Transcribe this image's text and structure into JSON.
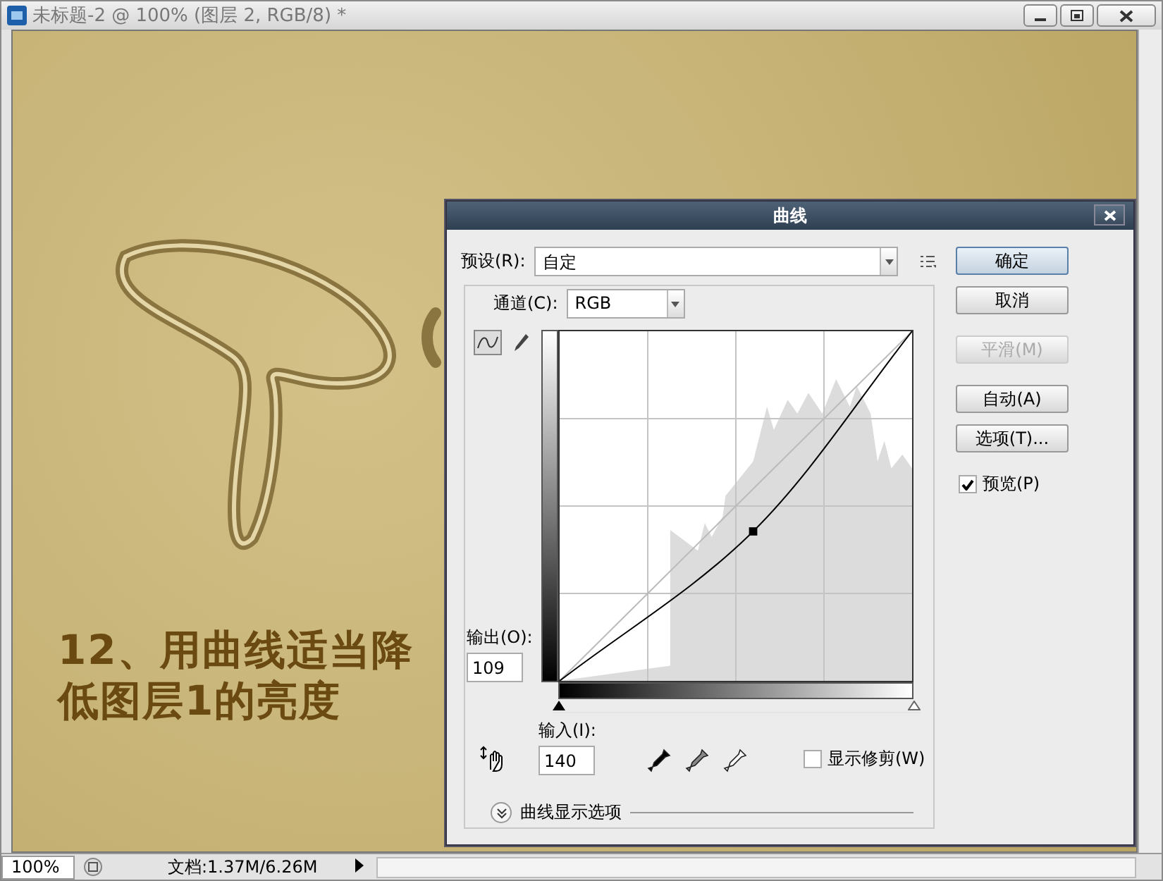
{
  "window": {
    "title": "未标题-2 @ 100% (图层 2, RGB/8) *"
  },
  "canvas": {
    "caption_lines": [
      "12、用曲线适当降",
      "低图层1的亮度"
    ]
  },
  "dialog": {
    "title": "曲线",
    "preset": {
      "label": "预设(R):",
      "value": "自定"
    },
    "channel": {
      "label": "通道(C):",
      "value": "RGB"
    },
    "buttons": [
      {
        "label": "确定",
        "disabled": false,
        "default": true
      },
      {
        "label": "取消",
        "disabled": false,
        "default": false
      },
      {
        "label": "平滑(M)",
        "disabled": true,
        "default": false
      },
      {
        "label": "自动(A)",
        "disabled": false,
        "default": false
      },
      {
        "label": "选项(T)...",
        "disabled": false,
        "default": false
      }
    ],
    "preview": {
      "label": "预览(P)",
      "checked": true
    },
    "output": {
      "label": "输出(O):",
      "value": "109"
    },
    "input": {
      "label": "输入(I):",
      "value": "140"
    },
    "input_sliders": [
      {
        "level": 0
      },
      {
        "level": 1
      }
    ],
    "show_clipping": {
      "label": "显示修剪(W)",
      "checked": false
    },
    "display_options": {
      "label": "曲线显示选项"
    }
  },
  "status_bar": {
    "zoom": "100%",
    "doc_info": "文档:1.37M/6.26M"
  }
}
